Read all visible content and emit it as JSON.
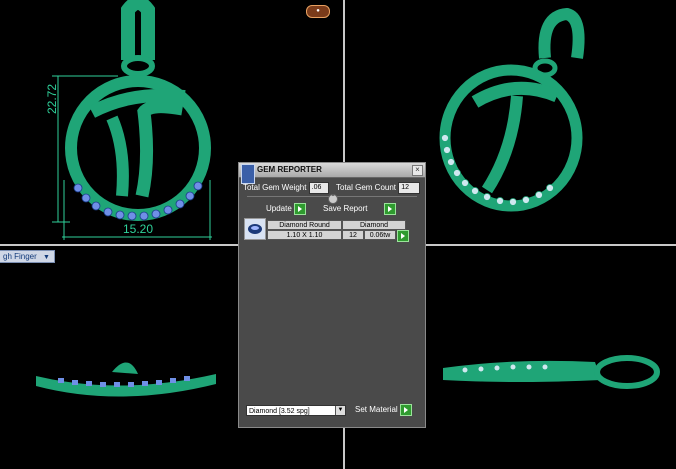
{
  "viewports": {
    "top_left": {
      "dim_height": "22.72",
      "dim_width": "15.20"
    },
    "view_mode_label": "gh Finger"
  },
  "colors": {
    "model_green": "#1fa577",
    "gem_blue": "#6f8fe6",
    "dim_color": "#2fd19a",
    "panel_bg": "#4a4a4a"
  },
  "panel": {
    "title": "GEM REPORTER",
    "total_gem_weight_label": "Total Gem Weight",
    "total_gem_weight_value": ".06",
    "total_gem_count_label": "Total Gem Count",
    "total_gem_count_value": "12",
    "update_label": "Update",
    "save_report_label": "Save Report",
    "table": {
      "headers": [
        "Diamond Round",
        "Diamond"
      ],
      "row": {
        "size": "1.10 X 1.10",
        "count": "12",
        "weight": "0.06tw"
      }
    },
    "material_select": "Diamond    [3.52 spg]",
    "set_material_label": "Set Material"
  },
  "icons": [
    "close-icon",
    "collapse-icon",
    "gem-icon",
    "play-icon"
  ]
}
